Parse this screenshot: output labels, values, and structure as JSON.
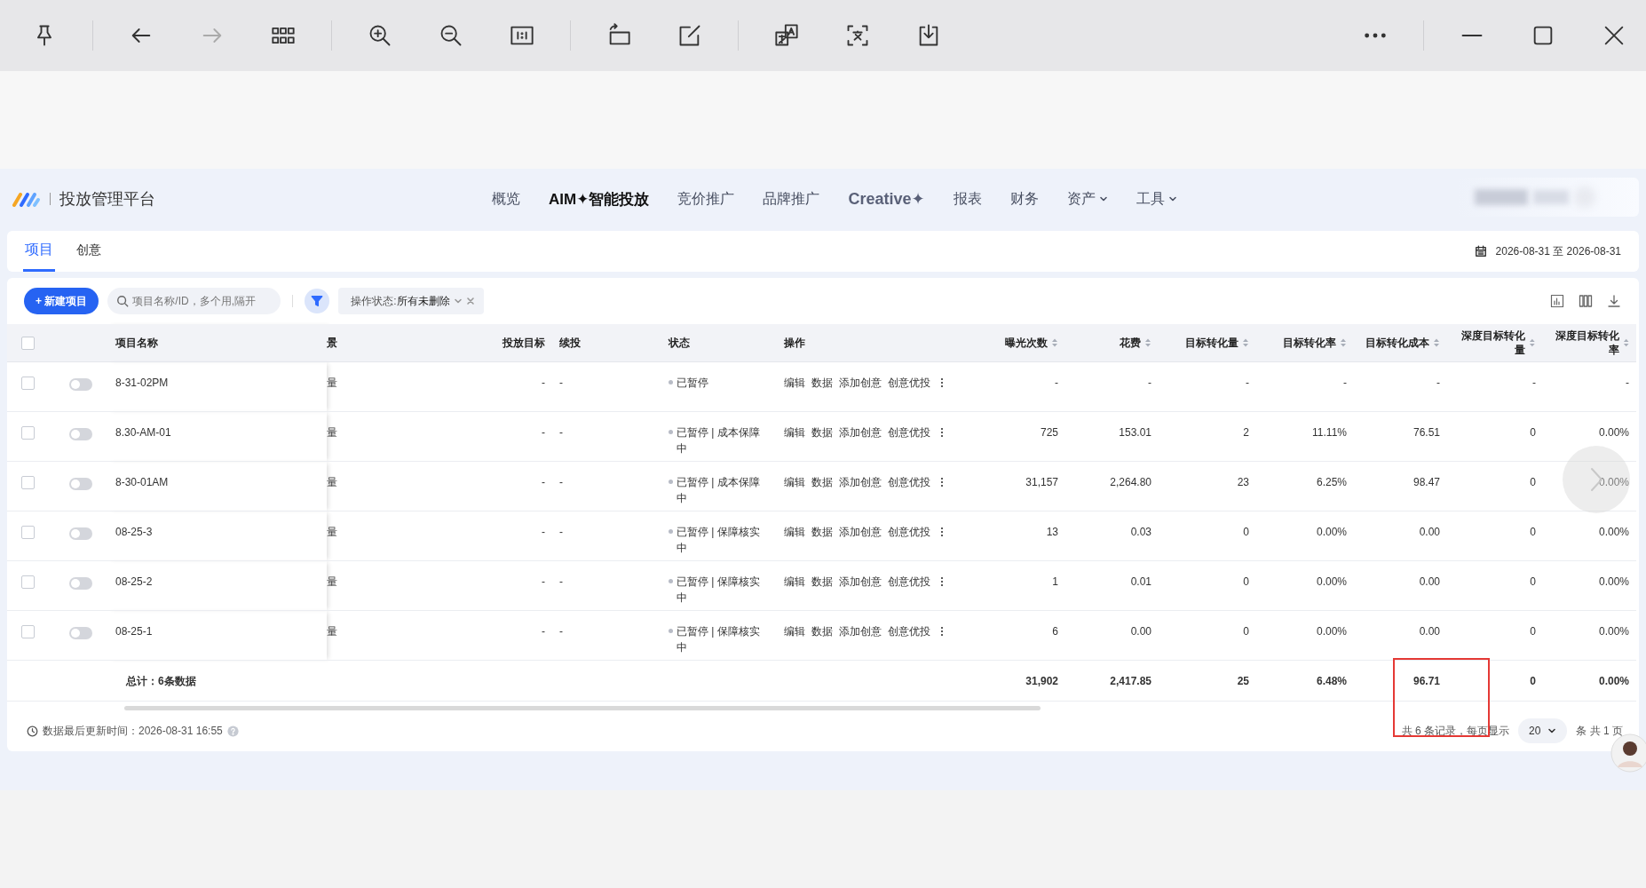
{
  "viewer_toolbar": {
    "groups": [
      [
        {
          "kind": "pin",
          "disabled": false
        }
      ],
      [
        {
          "kind": "back",
          "disabled": false
        },
        {
          "kind": "forward",
          "disabled": true
        },
        {
          "kind": "grid",
          "disabled": false
        }
      ],
      [
        {
          "kind": "zoom-in",
          "disabled": false
        },
        {
          "kind": "zoom-out",
          "disabled": false
        },
        {
          "kind": "actual-size",
          "disabled": false
        }
      ],
      [
        {
          "kind": "rotate",
          "disabled": false
        },
        {
          "kind": "edit",
          "disabled": false
        }
      ],
      [
        {
          "kind": "translate",
          "disabled": false
        },
        {
          "kind": "ocr",
          "disabled": false
        },
        {
          "kind": "download",
          "disabled": false
        }
      ]
    ],
    "window_groups": [
      [
        {
          "kind": "more"
        }
      ],
      [
        {
          "kind": "minimize"
        },
        {
          "kind": "maximize"
        },
        {
          "kind": "close"
        }
      ]
    ]
  },
  "header": {
    "platform_title": "投放管理平台",
    "nav": [
      {
        "label": "概览",
        "selected": false,
        "kind": "link"
      },
      {
        "label": "AIM✦智能投放",
        "selected": true,
        "kind": "link"
      },
      {
        "label": "竞价推广",
        "selected": false,
        "kind": "link"
      },
      {
        "label": "品牌推广",
        "selected": false,
        "kind": "link"
      },
      {
        "label": "Creative✦",
        "selected": false,
        "kind": "brand"
      },
      {
        "label": "报表",
        "selected": false,
        "kind": "link"
      },
      {
        "label": "财务",
        "selected": false,
        "kind": "link"
      },
      {
        "label": "资产",
        "selected": false,
        "kind": "menu"
      },
      {
        "label": "工具",
        "selected": false,
        "kind": "menu"
      }
    ]
  },
  "tabs": [
    {
      "label": "项目",
      "selected": true
    },
    {
      "label": "创意",
      "selected": false
    }
  ],
  "date_range": "2026-08-31 至 2026-08-31",
  "toolbar": {
    "new_button": "+ 新建项目",
    "search": {
      "placeholder": "项目名称/ID，多个用,隔开"
    },
    "filter_tag": {
      "label": "操作状态:",
      "value": "所有未删除"
    }
  },
  "table": {
    "header_checked": false,
    "columns": [
      {
        "label": "项目名称",
        "kind": "plain"
      },
      {
        "label": "景",
        "kind": "plain"
      },
      {
        "label": "投放目标",
        "kind": "plain"
      },
      {
        "label": "续投",
        "kind": "plain"
      },
      {
        "label": "状态",
        "kind": "plain"
      },
      {
        "label": "操作",
        "kind": "plain"
      },
      {
        "label": "曝光次数",
        "kind": "sortable"
      },
      {
        "label": "花费",
        "kind": "sortable"
      },
      {
        "label": "目标转化量",
        "kind": "sortable"
      },
      {
        "label": "目标转化率",
        "kind": "sortable"
      },
      {
        "label": "目标转化成本",
        "kind": "sortable"
      },
      {
        "label": "深度目标转化量",
        "kind": "sortable"
      },
      {
        "label": "深度目标转化率",
        "kind": "sortable"
      }
    ],
    "rows": [
      {
        "checked": false,
        "on": false,
        "name": "8-31-02PM",
        "scene": "量",
        "target": "-",
        "renew": "-",
        "status": "已暂停",
        "actions": [
          "编辑",
          "数据",
          "添加创意",
          "创意优投"
        ],
        "metrics": [
          "-",
          "-",
          "-",
          "-",
          "-",
          "-",
          "-"
        ]
      },
      {
        "checked": false,
        "on": false,
        "name": "8.30-AM-01",
        "scene": "量",
        "target": "-",
        "renew": "-",
        "status": "已暂停 | 成本保障中",
        "actions": [
          "编辑",
          "数据",
          "添加创意",
          "创意优投"
        ],
        "metrics": [
          "725",
          "153.01",
          "2",
          "11.11%",
          "76.51",
          "0",
          "0.00%"
        ]
      },
      {
        "checked": false,
        "on": false,
        "name": "8-30-01AM",
        "scene": "量",
        "target": "-",
        "renew": "-",
        "status": "已暂停 | 成本保障中",
        "actions": [
          "编辑",
          "数据",
          "添加创意",
          "创意优投"
        ],
        "metrics": [
          "31,157",
          "2,264.80",
          "23",
          "6.25%",
          "98.47",
          "0",
          "0.00%"
        ]
      },
      {
        "checked": false,
        "on": false,
        "name": "08-25-3",
        "scene": "量",
        "target": "-",
        "renew": "-",
        "status": "已暂停 | 保障核实中",
        "actions": [
          "编辑",
          "数据",
          "添加创意",
          "创意优投"
        ],
        "metrics": [
          "13",
          "0.03",
          "0",
          "0.00%",
          "0.00",
          "0",
          "0.00%"
        ]
      },
      {
        "checked": false,
        "on": false,
        "name": "08-25-2",
        "scene": "量",
        "target": "-",
        "renew": "-",
        "status": "已暂停 | 保障核实中",
        "actions": [
          "编辑",
          "数据",
          "添加创意",
          "创意优投"
        ],
        "metrics": [
          "1",
          "0.01",
          "0",
          "0.00%",
          "0.00",
          "0",
          "0.00%"
        ]
      },
      {
        "checked": false,
        "on": false,
        "name": "08-25-1",
        "scene": "量",
        "target": "-",
        "renew": "-",
        "status": "已暂停 | 保障核实中",
        "actions": [
          "编辑",
          "数据",
          "添加创意",
          "创意优投"
        ],
        "metrics": [
          "6",
          "0.00",
          "0",
          "0.00%",
          "0.00",
          "0",
          "0.00%"
        ]
      }
    ],
    "total": {
      "label": "总计：6条数据",
      "metrics": [
        "31,902",
        "2,417.85",
        "25",
        "6.48%",
        "96.71",
        "0",
        "0.00%"
      ]
    }
  },
  "footer": {
    "updated": "数据最后更新时间：2026-08-31 16:55",
    "total_text": "共 6 条记录，每页显示",
    "page_size": "20",
    "pages_text": "条 共 1 页"
  },
  "annotations": [
    {
      "kind": "red-box"
    }
  ]
}
